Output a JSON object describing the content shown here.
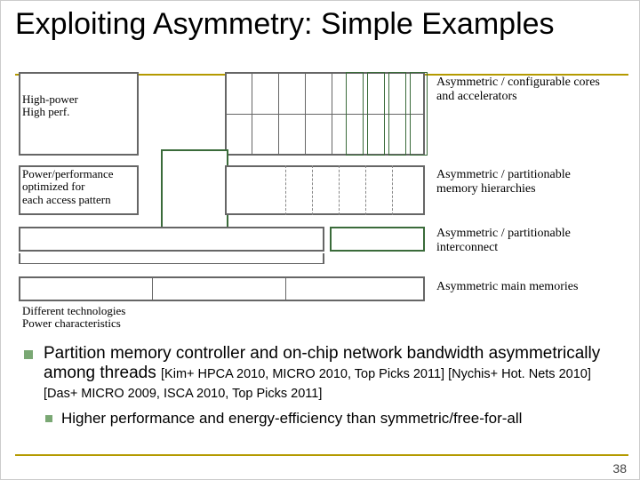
{
  "title": "Exploiting Asymmetry: Simple Examples",
  "diagram": {
    "row1_left": "High-power\nHigh perf.",
    "row2_left": "Power/performance\noptimized for\neach access pattern",
    "row4_left": "Different technologies\nPower characteristics",
    "right1": "Asymmetric / configurable cores and accelerators",
    "right2": "Asymmetric / partitionable memory hierarchies",
    "right3": "Asymmetric / partitionable interconnect",
    "right4": "Asymmetric main memories"
  },
  "bullet1_main": "Partition memory controller and on-chip network bandwidth asymmetrically among threads ",
  "bullet1_refs": "[Kim+ HPCA 2010, MICRO 2010, Top Picks 2011] [Nychis+ Hot. Nets 2010] [Das+ MICRO 2009, ISCA 2010, Top Picks 2011]",
  "bullet2": "Higher performance and energy-efficiency than symmetric/free-for-all",
  "page_number": "38"
}
